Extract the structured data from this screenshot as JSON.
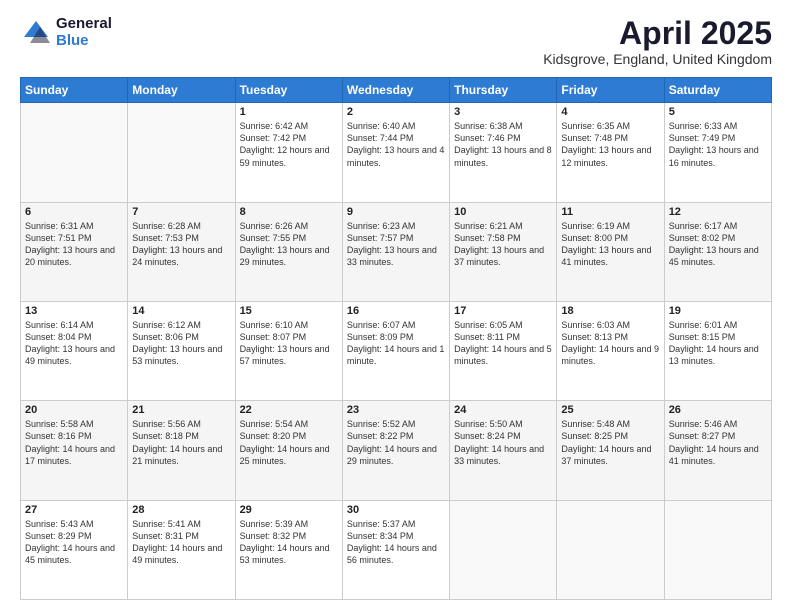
{
  "logo": {
    "general": "General",
    "blue": "Blue"
  },
  "title": "April 2025",
  "subtitle": "Kidsgrove, England, United Kingdom",
  "weekdays": [
    "Sunday",
    "Monday",
    "Tuesday",
    "Wednesday",
    "Thursday",
    "Friday",
    "Saturday"
  ],
  "weeks": [
    [
      {
        "day": "",
        "info": ""
      },
      {
        "day": "",
        "info": ""
      },
      {
        "day": "1",
        "info": "Sunrise: 6:42 AM\nSunset: 7:42 PM\nDaylight: 12 hours and 59 minutes."
      },
      {
        "day": "2",
        "info": "Sunrise: 6:40 AM\nSunset: 7:44 PM\nDaylight: 13 hours and 4 minutes."
      },
      {
        "day": "3",
        "info": "Sunrise: 6:38 AM\nSunset: 7:46 PM\nDaylight: 13 hours and 8 minutes."
      },
      {
        "day": "4",
        "info": "Sunrise: 6:35 AM\nSunset: 7:48 PM\nDaylight: 13 hours and 12 minutes."
      },
      {
        "day": "5",
        "info": "Sunrise: 6:33 AM\nSunset: 7:49 PM\nDaylight: 13 hours and 16 minutes."
      }
    ],
    [
      {
        "day": "6",
        "info": "Sunrise: 6:31 AM\nSunset: 7:51 PM\nDaylight: 13 hours and 20 minutes."
      },
      {
        "day": "7",
        "info": "Sunrise: 6:28 AM\nSunset: 7:53 PM\nDaylight: 13 hours and 24 minutes."
      },
      {
        "day": "8",
        "info": "Sunrise: 6:26 AM\nSunset: 7:55 PM\nDaylight: 13 hours and 29 minutes."
      },
      {
        "day": "9",
        "info": "Sunrise: 6:23 AM\nSunset: 7:57 PM\nDaylight: 13 hours and 33 minutes."
      },
      {
        "day": "10",
        "info": "Sunrise: 6:21 AM\nSunset: 7:58 PM\nDaylight: 13 hours and 37 minutes."
      },
      {
        "day": "11",
        "info": "Sunrise: 6:19 AM\nSunset: 8:00 PM\nDaylight: 13 hours and 41 minutes."
      },
      {
        "day": "12",
        "info": "Sunrise: 6:17 AM\nSunset: 8:02 PM\nDaylight: 13 hours and 45 minutes."
      }
    ],
    [
      {
        "day": "13",
        "info": "Sunrise: 6:14 AM\nSunset: 8:04 PM\nDaylight: 13 hours and 49 minutes."
      },
      {
        "day": "14",
        "info": "Sunrise: 6:12 AM\nSunset: 8:06 PM\nDaylight: 13 hours and 53 minutes."
      },
      {
        "day": "15",
        "info": "Sunrise: 6:10 AM\nSunset: 8:07 PM\nDaylight: 13 hours and 57 minutes."
      },
      {
        "day": "16",
        "info": "Sunrise: 6:07 AM\nSunset: 8:09 PM\nDaylight: 14 hours and 1 minute."
      },
      {
        "day": "17",
        "info": "Sunrise: 6:05 AM\nSunset: 8:11 PM\nDaylight: 14 hours and 5 minutes."
      },
      {
        "day": "18",
        "info": "Sunrise: 6:03 AM\nSunset: 8:13 PM\nDaylight: 14 hours and 9 minutes."
      },
      {
        "day": "19",
        "info": "Sunrise: 6:01 AM\nSunset: 8:15 PM\nDaylight: 14 hours and 13 minutes."
      }
    ],
    [
      {
        "day": "20",
        "info": "Sunrise: 5:58 AM\nSunset: 8:16 PM\nDaylight: 14 hours and 17 minutes."
      },
      {
        "day": "21",
        "info": "Sunrise: 5:56 AM\nSunset: 8:18 PM\nDaylight: 14 hours and 21 minutes."
      },
      {
        "day": "22",
        "info": "Sunrise: 5:54 AM\nSunset: 8:20 PM\nDaylight: 14 hours and 25 minutes."
      },
      {
        "day": "23",
        "info": "Sunrise: 5:52 AM\nSunset: 8:22 PM\nDaylight: 14 hours and 29 minutes."
      },
      {
        "day": "24",
        "info": "Sunrise: 5:50 AM\nSunset: 8:24 PM\nDaylight: 14 hours and 33 minutes."
      },
      {
        "day": "25",
        "info": "Sunrise: 5:48 AM\nSunset: 8:25 PM\nDaylight: 14 hours and 37 minutes."
      },
      {
        "day": "26",
        "info": "Sunrise: 5:46 AM\nSunset: 8:27 PM\nDaylight: 14 hours and 41 minutes."
      }
    ],
    [
      {
        "day": "27",
        "info": "Sunrise: 5:43 AM\nSunset: 8:29 PM\nDaylight: 14 hours and 45 minutes."
      },
      {
        "day": "28",
        "info": "Sunrise: 5:41 AM\nSunset: 8:31 PM\nDaylight: 14 hours and 49 minutes."
      },
      {
        "day": "29",
        "info": "Sunrise: 5:39 AM\nSunset: 8:32 PM\nDaylight: 14 hours and 53 minutes."
      },
      {
        "day": "30",
        "info": "Sunrise: 5:37 AM\nSunset: 8:34 PM\nDaylight: 14 hours and 56 minutes."
      },
      {
        "day": "",
        "info": ""
      },
      {
        "day": "",
        "info": ""
      },
      {
        "day": "",
        "info": ""
      }
    ]
  ]
}
